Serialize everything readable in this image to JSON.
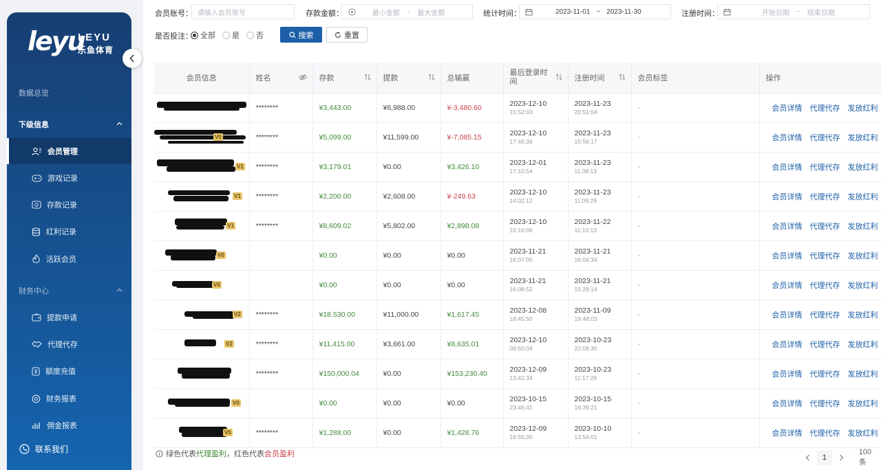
{
  "brand": {
    "logo_main": "leyu",
    "logo_en": "LEYU",
    "logo_cn": "乐鱼体育"
  },
  "sidebar": {
    "sections": [
      {
        "label": "数据总览"
      },
      {
        "label": "下级信息"
      },
      {
        "label": "财务中心"
      }
    ],
    "items": [
      {
        "label": "会员管理",
        "icon": "user-group-icon"
      },
      {
        "label": "游戏记录",
        "icon": "gamepad-icon"
      },
      {
        "label": "存款记录",
        "icon": "deposit-icon"
      },
      {
        "label": "红利记录",
        "icon": "database-icon"
      },
      {
        "label": "活跃会员",
        "icon": "flame-icon"
      },
      {
        "label": "提款申请",
        "icon": "wallet-icon"
      },
      {
        "label": "代理代存",
        "icon": "handshake-icon"
      },
      {
        "label": "额度充值",
        "icon": "yen-icon"
      },
      {
        "label": "财务报表",
        "icon": "report-icon"
      },
      {
        "label": "佣金报表",
        "icon": "bar-chart-icon"
      }
    ],
    "contact": "联系我们"
  },
  "filters": {
    "account_label": "会员账号：",
    "account_placeholder": "请输入会员账号",
    "deposit_label": "存款金额：",
    "deposit_min_placeholder": "最小金额",
    "deposit_sep": "-",
    "deposit_max_placeholder": "最大金额",
    "stat_label": "统计时间：",
    "stat_start": "2023-11-01",
    "stat_sep": "~",
    "stat_end": "2023-11-30",
    "reg_label": "注册时间：",
    "reg_start_placeholder": "开始日期",
    "reg_sep": "~",
    "reg_end_placeholder": "结束日期",
    "bet_label": "是否投注：",
    "bet_options": [
      "全部",
      "是",
      "否"
    ],
    "search_btn": "搜索",
    "reset_btn": "重置"
  },
  "table": {
    "headers": [
      "会员信息",
      "姓名",
      "存款",
      "提款",
      "总输赢",
      "最后登录时间",
      "注册时间",
      "会员标签",
      "操作"
    ],
    "ops": [
      "会员详情",
      "代理代存",
      "发放红利"
    ],
    "rows": [
      {
        "vip": "",
        "name": "********",
        "deposit": "¥3,443.00",
        "withdraw": "¥6,988.00",
        "total": "¥-3,480.60",
        "total_sign": "neg",
        "login_date": "2023-12-10",
        "login_time": "15:52:03",
        "reg_date": "2023-11-23",
        "reg_time": "20:51:04",
        "tag": "-"
      },
      {
        "vip": "V0",
        "name": "********",
        "deposit": "¥5,099.00",
        "withdraw": "¥11,599.00",
        "total": "¥-7,085.15",
        "total_sign": "neg",
        "login_date": "2023-12-10",
        "login_time": "17:46:36",
        "reg_date": "2023-11-23",
        "reg_time": "15:56:17",
        "tag": "-"
      },
      {
        "vip": "V1",
        "name": "********",
        "deposit": "¥3,179.01",
        "withdraw": "¥0.00",
        "total": "¥3,426.10",
        "total_sign": "pos",
        "login_date": "2023-12-01",
        "login_time": "17:10:54",
        "reg_date": "2023-11-23",
        "reg_time": "11:38:13",
        "tag": "-"
      },
      {
        "vip": "V1",
        "name": "********",
        "deposit": "¥2,200.00",
        "withdraw": "¥2,608.00",
        "total": "¥-249.63",
        "total_sign": "neg",
        "login_date": "2023-12-10",
        "login_time": "14:02:12",
        "reg_date": "2023-11-23",
        "reg_time": "11:09:29",
        "tag": "-"
      },
      {
        "vip": "V1",
        "name": "********",
        "deposit": "¥8,609.02",
        "withdraw": "¥5,802.00",
        "total": "¥2,898.08",
        "total_sign": "pos",
        "login_date": "2023-12-10",
        "login_time": "15:16:06",
        "reg_date": "2023-11-22",
        "reg_time": "11:10:13",
        "tag": "-"
      },
      {
        "vip": "V0",
        "name": "",
        "deposit": "¥0.00",
        "withdraw": "¥0.00",
        "total": "¥0.00",
        "total_sign": "black",
        "login_date": "2023-11-21",
        "login_time": "16:07:05",
        "reg_date": "2023-11-21",
        "reg_time": "16:04:34",
        "tag": "-"
      },
      {
        "vip": "V0",
        "name": "",
        "deposit": "¥0.00",
        "withdraw": "¥0.00",
        "total": "¥0.00",
        "total_sign": "black",
        "login_date": "2023-11-21",
        "login_time": "16:08:52",
        "reg_date": "2023-11-21",
        "reg_time": "15:29:14",
        "tag": "-"
      },
      {
        "vip": "V2",
        "name": "********",
        "deposit": "¥18,530.00",
        "withdraw": "¥11,000.00",
        "total": "¥1,617.45",
        "total_sign": "pos",
        "login_date": "2023-12-08",
        "login_time": "18:45:50",
        "reg_date": "2023-11-09",
        "reg_time": "19:48:03",
        "tag": "-"
      },
      {
        "vip": "V2",
        "name": "********",
        "deposit": "¥11,415.00",
        "withdraw": "¥3,661.00",
        "total": "¥8,635.01",
        "total_sign": "pos",
        "login_date": "2023-12-10",
        "login_time": "09:50:04",
        "reg_date": "2023-10-23",
        "reg_time": "22:08:30",
        "tag": "-"
      },
      {
        "vip": "",
        "name": "********",
        "deposit": "¥150,000.04",
        "withdraw": "¥0.00",
        "total": "¥153,230.40",
        "total_sign": "pos",
        "login_date": "2023-12-09",
        "login_time": "13:42:34",
        "reg_date": "2023-10-23",
        "reg_time": "11:17:28",
        "tag": "-"
      },
      {
        "vip": "V0",
        "name": "",
        "deposit": "¥0.00",
        "withdraw": "¥0.00",
        "total": "¥0.00",
        "total_sign": "black",
        "login_date": "2023-10-15",
        "login_time": "23:46:41",
        "reg_date": "2023-10-15",
        "reg_time": "16:39:21",
        "tag": "-"
      },
      {
        "vip": "V0",
        "name": "********",
        "deposit": "¥1,288.00",
        "withdraw": "¥0.00",
        "total": "¥1,428.76",
        "total_sign": "pos",
        "login_date": "2023-12-09",
        "login_time": "16:55:00",
        "reg_date": "2023-10-10",
        "reg_time": "13:54:01",
        "tag": "-"
      }
    ]
  },
  "footer": {
    "note_prefix": "绿色代表",
    "note_green": "代理盈利",
    "note_mid": "，红色代表",
    "note_red": "会员盈利",
    "page_current": "1",
    "page_size": "100 条"
  },
  "colors": {
    "primary": "#1d5fa8",
    "profit_green": "#3f8a36",
    "loss_red": "#c8404b"
  }
}
